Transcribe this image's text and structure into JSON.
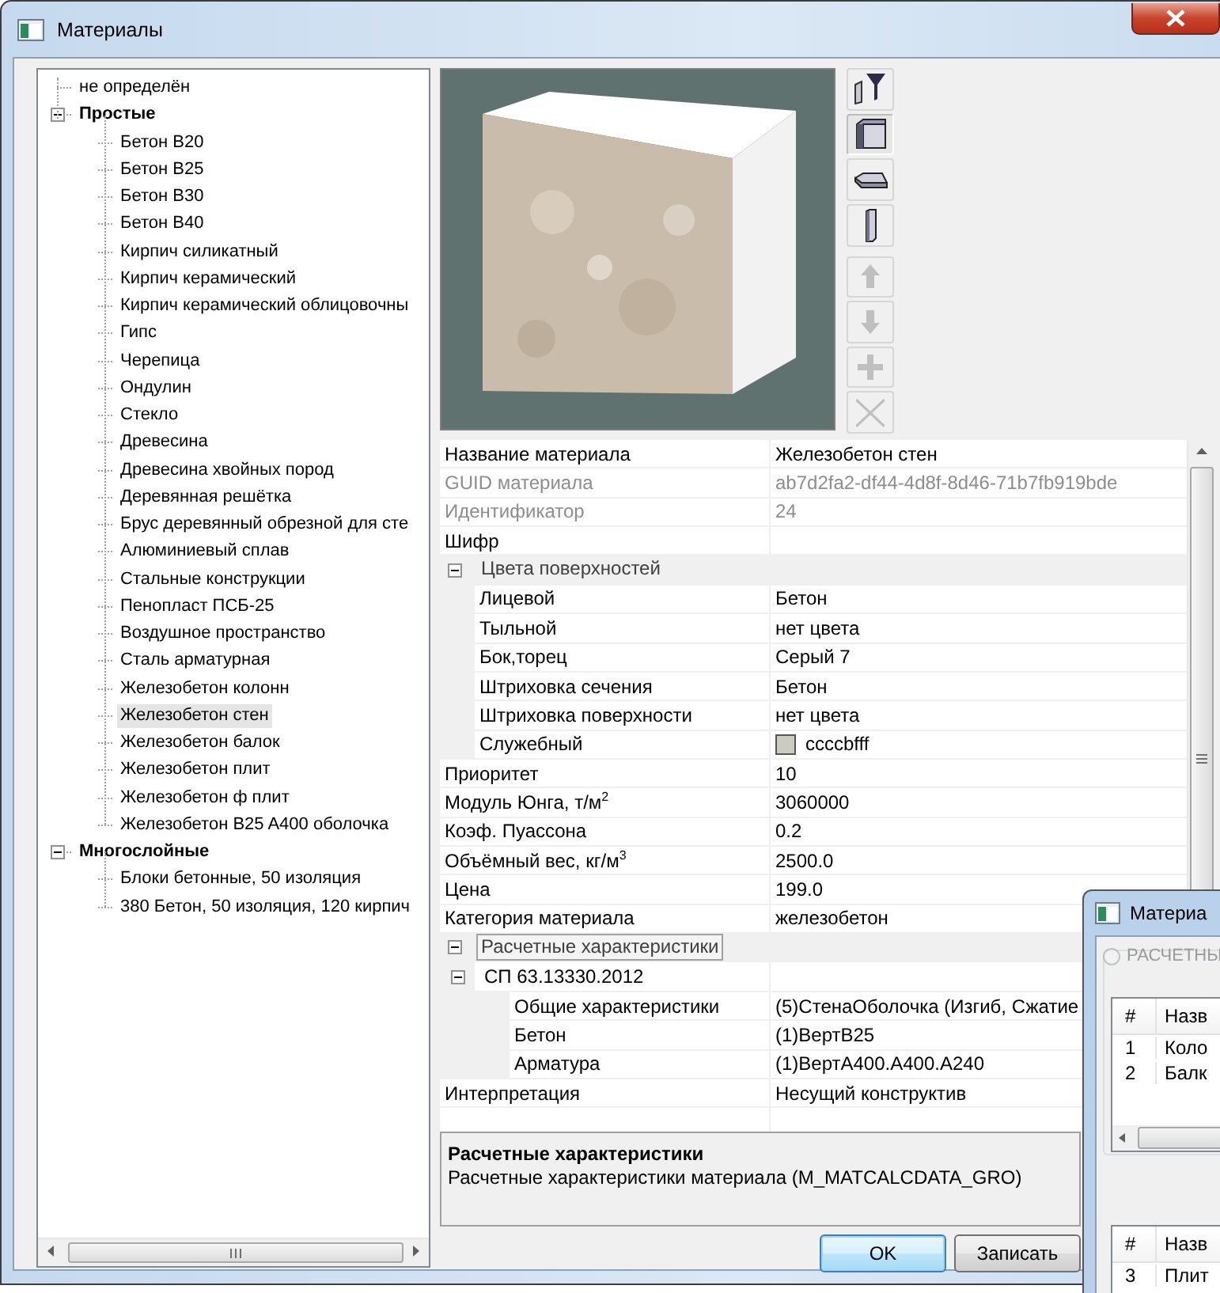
{
  "window": {
    "title": "Материалы"
  },
  "tree": [
    {
      "kind": "item",
      "label": "не определён",
      "selected": false
    },
    {
      "kind": "group",
      "label": "Простые",
      "expanded": true,
      "children": [
        {
          "kind": "item",
          "label": "Бетон B20",
          "selected": false
        },
        {
          "kind": "item",
          "label": "Бетон B25",
          "selected": false
        },
        {
          "kind": "item",
          "label": "Бетон B30",
          "selected": false
        },
        {
          "kind": "item",
          "label": "Бетон B40",
          "selected": false
        },
        {
          "kind": "item",
          "label": "Кирпич силикатный",
          "selected": false
        },
        {
          "kind": "item",
          "label": "Кирпич керамический",
          "selected": false
        },
        {
          "kind": "item",
          "label": "Кирпич керамический облицовочны",
          "selected": false
        },
        {
          "kind": "item",
          "label": "Гипс",
          "selected": false
        },
        {
          "kind": "item",
          "label": "Черепица",
          "selected": false
        },
        {
          "kind": "item",
          "label": "Ондулин",
          "selected": false
        },
        {
          "kind": "item",
          "label": "Стекло",
          "selected": false
        },
        {
          "kind": "item",
          "label": "Древесина",
          "selected": false
        },
        {
          "kind": "item",
          "label": "Древесина хвойных пород",
          "selected": false
        },
        {
          "kind": "item",
          "label": "Деревянная решётка",
          "selected": false
        },
        {
          "kind": "item",
          "label": "Брус деревянный обрезной для сте",
          "selected": false
        },
        {
          "kind": "item",
          "label": "Алюминиевый сплав",
          "selected": false
        },
        {
          "kind": "item",
          "label": "Стальные конструкции",
          "selected": false
        },
        {
          "kind": "item",
          "label": "Пенопласт ПСБ-25",
          "selected": false
        },
        {
          "kind": "item",
          "label": "Воздушное пространство",
          "selected": false
        },
        {
          "kind": "item",
          "label": "Сталь арматурная",
          "selected": false
        },
        {
          "kind": "item",
          "label": "Железобетон колонн",
          "selected": false
        },
        {
          "kind": "item",
          "label": "Железобетон стен",
          "selected": true
        },
        {
          "kind": "item",
          "label": "Железобетон балок",
          "selected": false
        },
        {
          "kind": "item",
          "label": "Железобетон плит",
          "selected": false
        },
        {
          "kind": "item",
          "label": "Железобетон ф плит",
          "selected": false
        },
        {
          "kind": "item",
          "label": "Железобетон B25 A400 оболочка",
          "selected": false
        }
      ]
    },
    {
      "kind": "group",
      "label": "Многослойные",
      "expanded": true,
      "children": [
        {
          "kind": "item",
          "label": "Блоки бетонные, 50 изоляция",
          "selected": false
        },
        {
          "kind": "item",
          "label": "380 Бетон, 50 изоляция, 120 кирпич",
          "selected": false
        }
      ]
    }
  ],
  "toolbar": [
    {
      "kind": "filter",
      "disabled": false,
      "pressed": false
    },
    {
      "kind": "box",
      "disabled": false,
      "pressed": true
    },
    {
      "kind": "slab",
      "disabled": false,
      "pressed": false
    },
    {
      "kind": "column",
      "disabled": false,
      "pressed": false
    },
    {
      "kind": "up",
      "disabled": true,
      "pressed": false
    },
    {
      "kind": "down",
      "disabled": true,
      "pressed": false
    },
    {
      "kind": "add",
      "disabled": true,
      "pressed": false
    },
    {
      "kind": "delete",
      "disabled": true,
      "pressed": false
    }
  ],
  "properties": [
    {
      "kind": "prop",
      "name": "Название материала",
      "value": "Железобетон стен",
      "disabled": false
    },
    {
      "kind": "prop",
      "name": "GUID материала",
      "value": "ab7d2fa2-df44-4d8f-8d46-71b7fb919bde",
      "disabled": true
    },
    {
      "kind": "prop",
      "name": "Идентификатор",
      "value": "24",
      "disabled": true
    },
    {
      "kind": "prop",
      "name": "Шифр",
      "disabled": false
    },
    {
      "kind": "group",
      "name": "Цвета поверхностей",
      "expanded": true,
      "selected": false,
      "children": [
        {
          "kind": "prop",
          "name": "Лицевой",
          "value": "Бетон",
          "disabled": false
        },
        {
          "kind": "prop",
          "name": "Тыльной",
          "value": "нет цвета",
          "disabled": false
        },
        {
          "kind": "prop",
          "name": "Бок,торец",
          "value": "Серый 7",
          "disabled": false
        },
        {
          "kind": "prop",
          "name": "Штриховка сечения",
          "value": "Бетон",
          "disabled": false
        },
        {
          "kind": "prop",
          "name": "Штриховка поверхности",
          "value": "нет цвета",
          "disabled": false
        },
        {
          "kind": "color",
          "name": "Служебный",
          "value": "ccccbfff",
          "color": "#cccbbf",
          "disabled": false
        }
      ]
    },
    {
      "kind": "prop",
      "name": "Приоритет",
      "value": "10",
      "disabled": false
    },
    {
      "kind": "prop",
      "name": "Модуль Юнга, т/м$^{2}$",
      "value": "3060000",
      "disabled": false
    },
    {
      "kind": "prop",
      "name": "Коэф. Пуассона",
      "value": "0.2",
      "disabled": false
    },
    {
      "kind": "prop",
      "name": "Объёмный вес, кг/м$^{3}$",
      "value": "2500.0",
      "disabled": false
    },
    {
      "kind": "prop",
      "name": "Цена",
      "value": "199.0",
      "disabled": false
    },
    {
      "kind": "prop",
      "name": "Категория материала",
      "value": "железобетон",
      "disabled": false
    },
    {
      "kind": "group",
      "name": "Расчетные характеристики",
      "expanded": true,
      "selected": true,
      "children": [
        {
          "kind": "group",
          "name": "СП 63.13330.2012",
          "expanded": true,
          "selected": false,
          "children": [
            {
              "kind": "prop",
              "name": "Общие характеристики",
              "value": "(5)СтенаОболочка (Изгиб, Сжатие",
              "disabled": false
            },
            {
              "kind": "prop",
              "name": "Бетон",
              "value": "(1)ВертB25",
              "disabled": false
            },
            {
              "kind": "prop",
              "name": "Арматура",
              "value": "(1)ВертA400.A400.A240",
              "disabled": false
            }
          ]
        }
      ]
    },
    {
      "kind": "prop",
      "name": "Интерпретация",
      "value": "Несущий конструктив",
      "disabled": false
    }
  ],
  "description": {
    "title": "Расчетные характеристики",
    "text": "Расчетные характеристики материала (M_MATCALCDATA_GRO)"
  },
  "buttons": [
    {
      "label": "OK",
      "default": true
    },
    {
      "label": "Записать",
      "default": false
    }
  ],
  "second_window": {
    "title": "Материа",
    "radio": {
      "label": "РАСЧЕТНЫ",
      "checked": false,
      "disabled": true
    },
    "tables": [
      {
        "columns": [
          "#",
          "Назв"
        ],
        "rows": [
          [
            "1",
            "Коло"
          ],
          [
            "2",
            "Балк"
          ]
        ]
      },
      {
        "columns": [
          "#",
          "Назв"
        ],
        "rows": [
          [
            "3",
            "Плит"
          ]
        ]
      }
    ]
  }
}
